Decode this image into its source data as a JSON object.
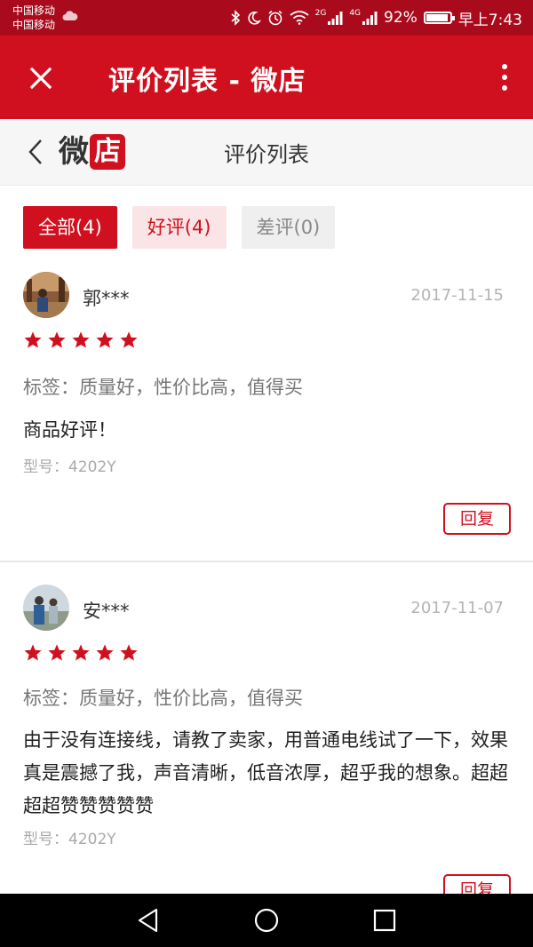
{
  "status_bar": {
    "carrier_1": "中国移动",
    "carrier_2": "中国移动",
    "net_1": "2G",
    "net_2": "4G",
    "battery_percent": "92%",
    "battery_level": 0.92,
    "time": "早上7:43",
    "icons": [
      "cloud-icon",
      "bluetooth-icon",
      "moon-icon",
      "alarm-icon",
      "wifi-icon",
      "signal-icon",
      "battery-icon"
    ]
  },
  "app_bar": {
    "title": "评价列表 - 微店",
    "icons": [
      "close-icon",
      "more-vertical-icon"
    ]
  },
  "sub_header": {
    "logo_part_1": "微",
    "logo_part_2": "店",
    "title": "评价列表",
    "icons": [
      "chevron-left-icon"
    ]
  },
  "filters": {
    "all": "全部(4)",
    "good": "好评(4)",
    "bad": "差评(0)",
    "selected": "all"
  },
  "colors": {
    "brand_red": "#d0101e",
    "status_bar": "#a90b1c",
    "star": "#d0101e"
  },
  "reviews": [
    {
      "user": "郭***",
      "date": "2017-11-15",
      "rating": 5,
      "tags": "标签：质量好，性价比高，值得买",
      "content": "商品好评！",
      "model": "型号：4202Y",
      "reply_label": "回复"
    },
    {
      "user": "安***",
      "date": "2017-11-07",
      "rating": 5,
      "tags": "标签：质量好，性价比高，值得买",
      "content": "由于没有连接线，请教了卖家，用普通电线试了一下，效果真是震撼了我，声音清晰，低音浓厚，超乎我的想象。超超超超赞赞赞赞赞",
      "model": "型号：4202Y",
      "reply_label": "回复"
    }
  ],
  "nav_bar": {
    "icons": [
      "back-triangle-icon",
      "home-circle-icon",
      "recents-square-icon"
    ]
  }
}
